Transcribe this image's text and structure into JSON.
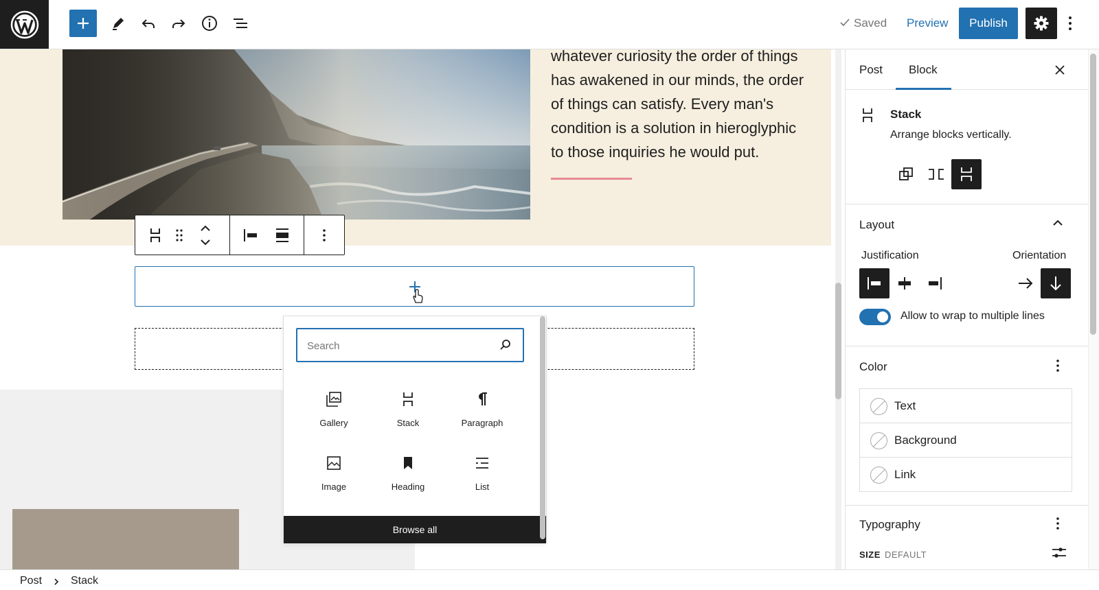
{
  "topbar": {
    "saved_label": "Saved",
    "preview_label": "Preview",
    "publish_label": "Publish"
  },
  "content": {
    "paragraph": "whatever curiosity the order of things has awakened in our minds, the order of things can satisfy. Every man's condition is a solution in hieroglyphic to those inquiries he would put."
  },
  "quick_inserter": {
    "search_placeholder": "Search",
    "items": [
      {
        "label": "Gallery",
        "icon": "gallery-icon"
      },
      {
        "label": "Stack",
        "icon": "stack-icon"
      },
      {
        "label": "Paragraph",
        "icon": "paragraph-icon"
      },
      {
        "label": "Image",
        "icon": "image-icon"
      },
      {
        "label": "Heading",
        "icon": "bookmark-icon"
      },
      {
        "label": "List",
        "icon": "list-icon"
      }
    ],
    "browse_all_label": "Browse all"
  },
  "sidebar": {
    "tabs": [
      "Post",
      "Block"
    ],
    "active_tab": "Block",
    "block_card": {
      "title": "Stack",
      "description": "Arrange blocks vertically."
    },
    "layout": {
      "title": "Layout",
      "justification_label": "Justification",
      "orientation_label": "Orientation",
      "wrap_label": "Allow to wrap to multiple lines",
      "wrap_enabled": true
    },
    "color": {
      "title": "Color",
      "items": [
        "Text",
        "Background",
        "Link"
      ]
    },
    "typography": {
      "title": "Typography",
      "size_label": "SIZE",
      "size_value": "DEFAULT"
    }
  },
  "breadcrumb": [
    "Post",
    "Stack"
  ],
  "colors": {
    "accent": "#2271b1",
    "dark": "#1e1e1e",
    "cream": "#f6efdf"
  }
}
